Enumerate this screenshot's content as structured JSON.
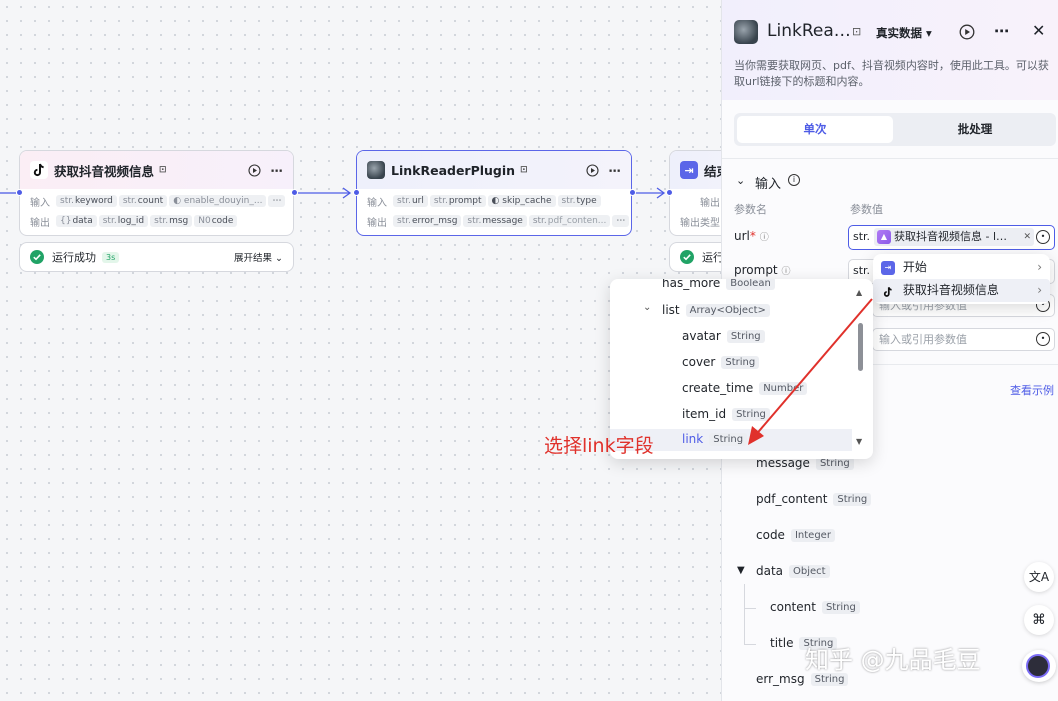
{
  "node1": {
    "title": "获取抖音视频信息",
    "input_label": "输入",
    "output_label": "输出",
    "inputs": [
      {
        "type": "str.",
        "name": "keyword"
      },
      {
        "type": "str.",
        "name": "count"
      },
      {
        "type": "toggle",
        "name": "enable_douyin_..."
      }
    ],
    "outputs": [
      {
        "type": "{}",
        "name": "data"
      },
      {
        "type": "str.",
        "name": "log_id"
      },
      {
        "type": "str.",
        "name": "msg"
      },
      {
        "type": "N0",
        "name": "code"
      }
    ],
    "status": "运行成功",
    "duration": "3s",
    "expand": "展开结果"
  },
  "node2": {
    "title": "LinkReaderPlugin",
    "input_label": "输入",
    "output_label": "输出",
    "inputs": [
      {
        "type": "str.",
        "name": "url"
      },
      {
        "type": "str.",
        "name": "prompt"
      },
      {
        "type": "toggle",
        "name": "skip_cache"
      },
      {
        "type": "str.",
        "name": "type"
      }
    ],
    "outputs": [
      {
        "type": "str.",
        "name": "error_msg"
      },
      {
        "type": "str.",
        "name": "message"
      },
      {
        "type": "str.",
        "name": "pdf_conten..."
      }
    ]
  },
  "node3": {
    "title": "结束",
    "row1": "输出",
    "row2": "输出类型",
    "status": "运行"
  },
  "panel": {
    "title": "LinkRea…",
    "data_mode": "真实数据",
    "description": "当你需要获取网页、pdf、抖音视频内容时，使用此工具。可以获取url链接下的标题和内容。",
    "tabs": [
      "单次",
      "批处理"
    ],
    "input_section": "输入",
    "param_name_header": "参数名",
    "param_value_header": "参数值",
    "params": [
      {
        "name": "url",
        "required": "*"
      },
      {
        "name": "prompt",
        "required": ""
      }
    ],
    "url_value_prefix": "str.",
    "url_value_ref": "获取抖音视频信息 - l…",
    "prompt_value_prefix": "str.",
    "placeholder": "输入或引用参数值",
    "view_example": "查看示例",
    "outputs": [
      {
        "name": "message",
        "type": "String"
      },
      {
        "name": "pdf_content",
        "type": "String"
      },
      {
        "name": "code",
        "type": "Integer"
      },
      {
        "name": "data",
        "type": "Object"
      },
      {
        "name": "content",
        "type": "String"
      },
      {
        "name": "title",
        "type": "String"
      },
      {
        "name": "err_msg",
        "type": "String"
      }
    ]
  },
  "ref_menu": {
    "items": [
      "开始",
      "获取抖音视频信息"
    ]
  },
  "var_tree": {
    "items": [
      {
        "name": "has_more",
        "type": "Boolean"
      },
      {
        "name": "list",
        "type": "Array<Object>"
      },
      {
        "name": "avatar",
        "type": "String"
      },
      {
        "name": "cover",
        "type": "String"
      },
      {
        "name": "create_time",
        "type": "Number"
      },
      {
        "name": "item_id",
        "type": "String"
      },
      {
        "name": "link",
        "type": "String"
      }
    ]
  },
  "annotation": "选择link字段",
  "watermark": "知乎 @九品毛豆",
  "colors": {
    "accent": "#4e5ce6",
    "annotation": "#e0312b",
    "success": "#21a366"
  }
}
